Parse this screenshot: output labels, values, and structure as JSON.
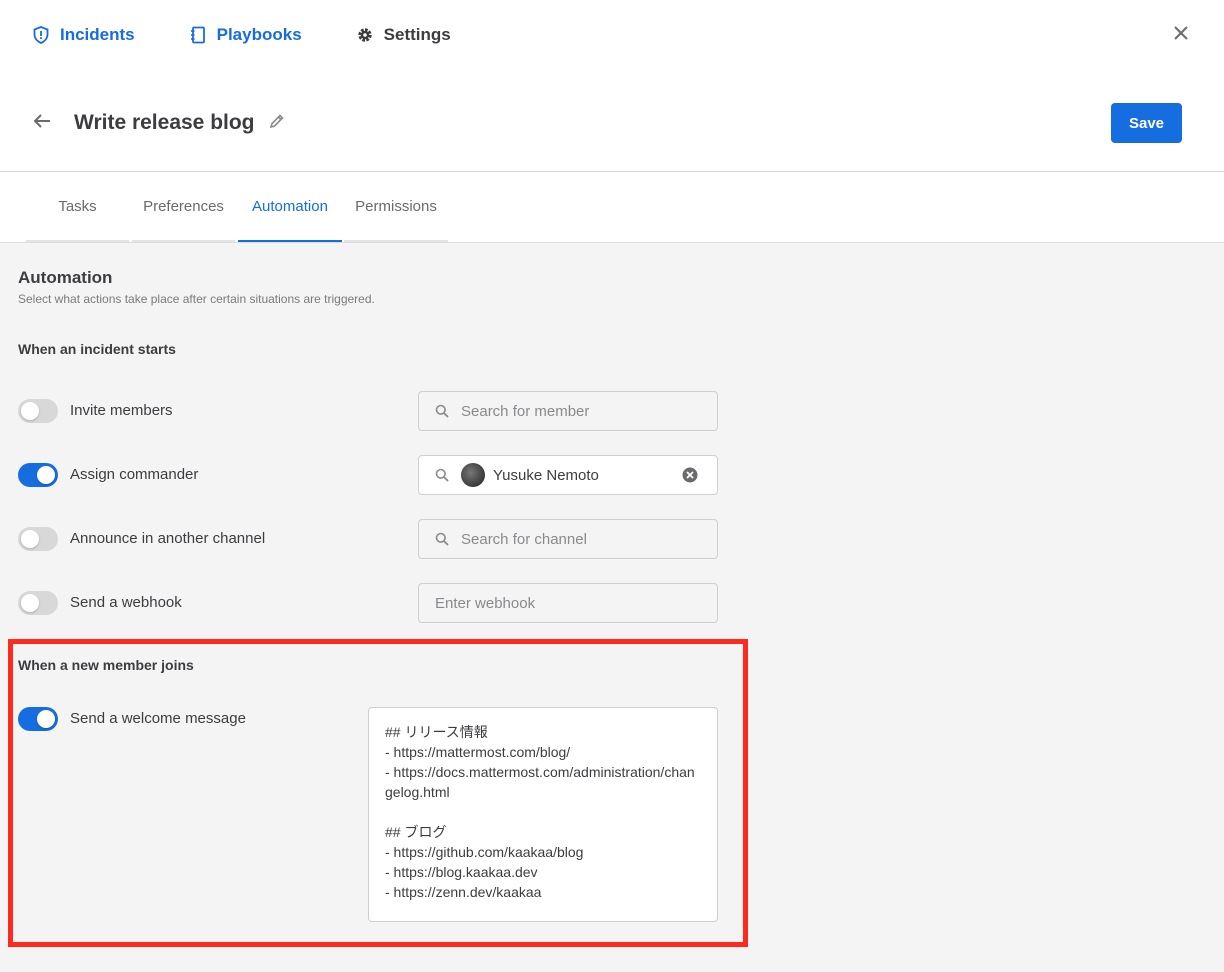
{
  "nav": {
    "incidents": "Incidents",
    "playbooks": "Playbooks",
    "settings": "Settings"
  },
  "header": {
    "title": "Write release blog",
    "save_label": "Save"
  },
  "tabs": [
    "Tasks",
    "Preferences",
    "Automation",
    "Permissions"
  ],
  "active_tab": "Automation",
  "automation": {
    "title": "Automation",
    "subtitle": "Select what actions take place after certain situations are triggered.",
    "incident_starts": {
      "heading": "When an incident starts",
      "invite_members": {
        "label": "Invite members",
        "enabled": false,
        "placeholder": "Search for member"
      },
      "assign_commander": {
        "label": "Assign commander",
        "enabled": true,
        "value": "Yusuke Nemoto"
      },
      "announce_channel": {
        "label": "Announce in another channel",
        "enabled": false,
        "placeholder": "Search for channel"
      },
      "send_webhook": {
        "label": "Send a webhook",
        "enabled": false,
        "placeholder": "Enter webhook"
      }
    },
    "member_joins": {
      "heading": "When a new member joins",
      "welcome_message": {
        "label": "Send a welcome message",
        "enabled": true,
        "text": "## リリース情報\n- https://mattermost.com/blog/\n- https://docs.mattermost.com/administration/changelog.html\n\n## ブログ\n- https://github.com/kaakaa/blog\n- https://blog.kaakaa.dev\n- https://zenn.dev/kaakaa"
      }
    }
  },
  "colors": {
    "accent": "#166de0",
    "highlight": "#ff2a1f"
  }
}
